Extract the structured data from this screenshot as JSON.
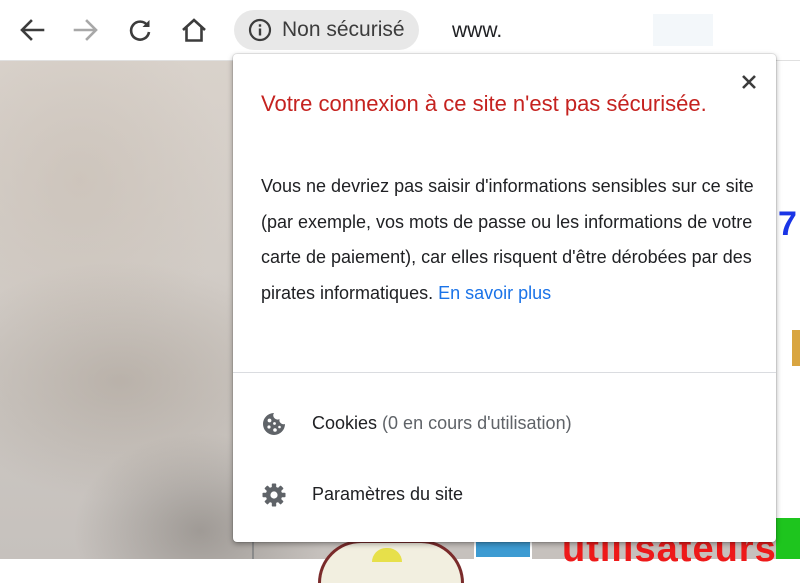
{
  "toolbar": {
    "back_icon": "arrow-left-icon",
    "forward_icon": "arrow-right-icon",
    "reload_icon": "reload-icon",
    "home_icon": "home-icon"
  },
  "omnibox": {
    "security_icon": "info-icon",
    "security_label": "Non sécurisé",
    "url_visible": "www."
  },
  "popup": {
    "close_icon": "close-icon",
    "title": "Votre connexion à ce site n'est pas sécurisée.",
    "body": "Vous ne devriez pas saisir d'informations sensibles sur ce site (par exemple, vos mots de passe ou les informations de votre carte de paiement), car elles risquent d'être dérobées par des pirates informatiques.",
    "learn_more": "En savoir plus",
    "cookies": {
      "icon": "cookie-icon",
      "label": "Cookies",
      "detail": "(0 en cours d'utilisation)"
    },
    "site_settings": {
      "icon": "gear-icon",
      "label": "Paramètres du site"
    }
  },
  "page_fragments": {
    "right_digit": "7",
    "bottom_text": "utilisateurs"
  },
  "colors": {
    "warning_title": "#c5221f",
    "link": "#1a73e8",
    "chip_background": "#e8e8e8"
  }
}
